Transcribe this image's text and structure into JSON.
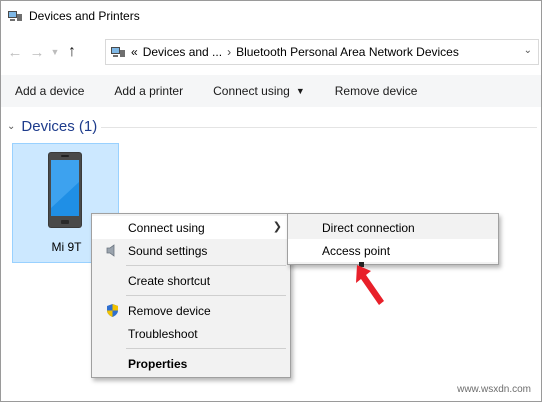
{
  "window": {
    "title": "Devices and Printers"
  },
  "address": {
    "overflow": "«",
    "crumbs": [
      "Devices and ...",
      "Bluetooth Personal Area Network Devices"
    ]
  },
  "toolbar": {
    "add_device": "Add a device",
    "add_printer": "Add a printer",
    "connect_using": "Connect using",
    "remove_device": "Remove device"
  },
  "group": {
    "label": "Devices (1)"
  },
  "device": {
    "name": "Mi 9T"
  },
  "context_menu": {
    "items": [
      {
        "label": "Connect using",
        "has_submenu": true
      },
      {
        "label": "Sound settings",
        "icon": "speaker-icon"
      },
      {
        "label": "Create shortcut"
      },
      {
        "label": "Remove device",
        "icon": "shield-icon"
      },
      {
        "label": "Troubleshoot"
      },
      {
        "label": "Properties",
        "bold": true
      }
    ]
  },
  "submenu": {
    "items": [
      {
        "label": "Direct connection"
      },
      {
        "label": "Access point",
        "highlighted": true
      }
    ]
  },
  "watermark": "www.wsxdn.com",
  "colors": {
    "selection": "#cce8ff",
    "group_header": "#1e3c8c",
    "annotation_arrow": "#e8202a"
  }
}
